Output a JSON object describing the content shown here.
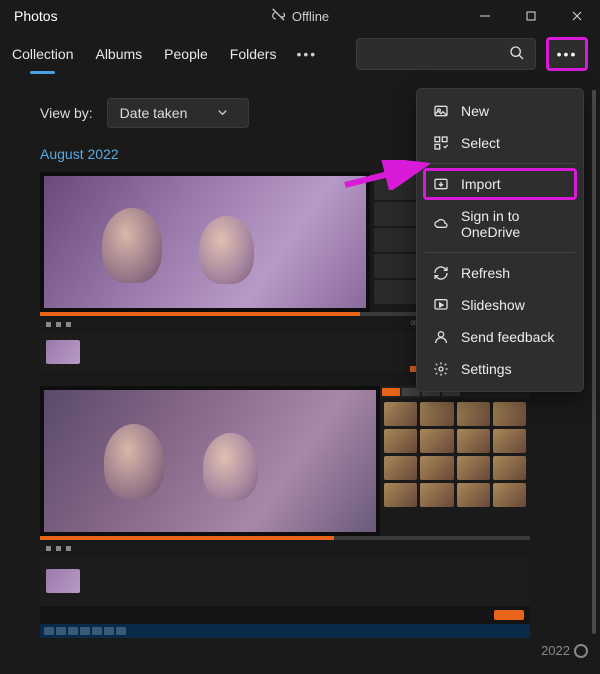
{
  "titlebar": {
    "app_title": "Photos",
    "offline_label": "Offline"
  },
  "navbar": {
    "tabs": [
      "Collection",
      "Albums",
      "People",
      "Folders"
    ]
  },
  "viewby": {
    "label": "View by:",
    "selected": "Date taken"
  },
  "date_header": "August 2022",
  "context_menu": {
    "items": [
      {
        "icon": "new-icon",
        "label": "New"
      },
      {
        "icon": "select-icon",
        "label": "Select"
      },
      {
        "divider": true
      },
      {
        "icon": "import-icon",
        "label": "Import",
        "highlight": true
      },
      {
        "icon": "onedrive-icon",
        "label": "Sign in to OneDrive"
      },
      {
        "divider": true
      },
      {
        "icon": "refresh-icon",
        "label": "Refresh"
      },
      {
        "icon": "slideshow-icon",
        "label": "Slideshow"
      },
      {
        "icon": "feedback-icon",
        "label": "Send feedback"
      },
      {
        "icon": "settings-icon",
        "label": "Settings"
      }
    ]
  },
  "year_indicator": "2022",
  "annotation_colors": {
    "highlight": "#d81bd8"
  }
}
